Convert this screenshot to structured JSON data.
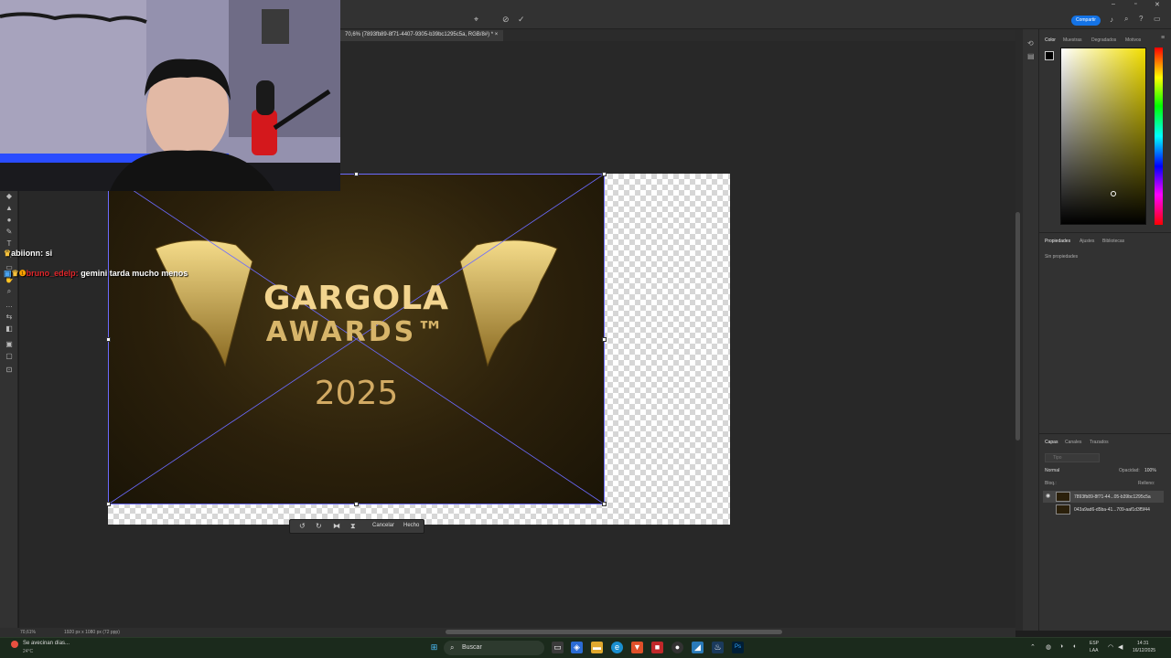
{
  "app": {
    "document_tab": "70,6% (7893fb89-8f71-4407-9305-b39bc1295c5a, RGB/8#) *",
    "share_button": "Compartir"
  },
  "canvas": {
    "artwork": {
      "title_line1": "GARGOLA",
      "title_line2": "AWARDS™",
      "year": "2025"
    },
    "transform_bar": {
      "cancel_label": "Cancelar",
      "done_label": "Hecho"
    }
  },
  "color_panel": {
    "tabs": [
      "Color",
      "Muestras",
      "Degradados",
      "Motivos"
    ]
  },
  "properties_panel": {
    "tabs": [
      "Propiedades",
      "Ajustes",
      "Bibliotecas"
    ],
    "content": "Sin propiedades"
  },
  "layers_panel": {
    "tabs": [
      "Capas",
      "Canales",
      "Trazados"
    ],
    "search_placeholder": "Tipo",
    "blend_mode": "Normal",
    "opacity_label": "Opacidad:",
    "opacity_value": "100%",
    "lock_label": "Bloq.:",
    "fill_label": "Relleno:",
    "layers": [
      {
        "name": "7893fb89-8f71-44...05-b39bc1295c5a"
      },
      {
        "name": "043a9ad6-d5ba-41...709-aaf1d3f5f44"
      }
    ]
  },
  "status_bar": {
    "zoom": "70,61%",
    "doc_info": "1920 px x 1080 px (72 ppp)"
  },
  "chat": [
    {
      "user": "abiionn:",
      "message": " si"
    },
    {
      "user": "bruno_edelp:",
      "message": " gemini tarda mucho menos"
    }
  ],
  "taskbar": {
    "weather_line1": "Se avecinan días...",
    "weather_line2": "24°C",
    "search_label": "Buscar",
    "lang_line1": "ESP",
    "lang_line2": "LAA",
    "time": "14:31",
    "date": "16/12/2025"
  }
}
